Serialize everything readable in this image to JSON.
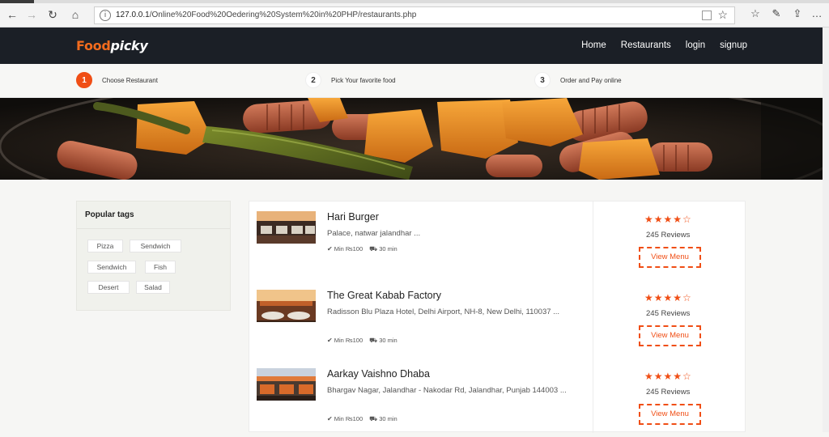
{
  "browser": {
    "url_prefix": "127.0.0.1",
    "url_path": "/Online%20Food%20Oedering%20System%20in%20PHP/restaurants.php"
  },
  "header": {
    "logo_part1": "Food",
    "logo_part2": "picky",
    "nav": [
      "Home",
      "Restaurants",
      "login",
      "signup"
    ]
  },
  "steps": [
    {
      "num": "1",
      "label": "Choose Restaurant"
    },
    {
      "num": "2",
      "label": "Pick Your favorite food"
    },
    {
      "num": "3",
      "label": "Order and Pay online"
    }
  ],
  "sidebar": {
    "title": "Popular tags",
    "tags": [
      "Pizza",
      "Sendwich",
      "Sendwich",
      "Fish",
      "Desert",
      "Salad"
    ]
  },
  "restaurants": [
    {
      "name": "Hari Burger",
      "address": "Palace, natwar jalandhar ...",
      "min_order": "Min ₨100",
      "delivery": "30 min",
      "rating": 4,
      "reviews": "245 Reviews",
      "button": "View Menu"
    },
    {
      "name": "The Great Kabab Factory",
      "address": "Radisson Blu Plaza Hotel, Delhi Airport, NH-8, New Delhi, 110037 ...",
      "min_order": "Min ₨100",
      "delivery": "30 min",
      "rating": 4,
      "reviews": "245 Reviews",
      "button": "View Menu"
    },
    {
      "name": "Aarkay Vaishno Dhaba",
      "address": "Bhargav Nagar, Jalandhar - Nakodar Rd, Jalandhar, Punjab 144003 ...",
      "min_order": "Min ₨100",
      "delivery": "30 min",
      "rating": 4,
      "reviews": "245 Reviews",
      "button": "View Menu"
    }
  ],
  "colors": {
    "accent": "#f04e15",
    "header_bg": "#1b1f26"
  },
  "icons": [
    "back-icon",
    "forward-icon",
    "refresh-icon",
    "home-icon",
    "info-icon",
    "reader-icon",
    "favorite-star-icon",
    "favorites-icon",
    "pen-icon",
    "share-icon",
    "check-icon",
    "motorcycle-icon",
    "star-icon"
  ]
}
